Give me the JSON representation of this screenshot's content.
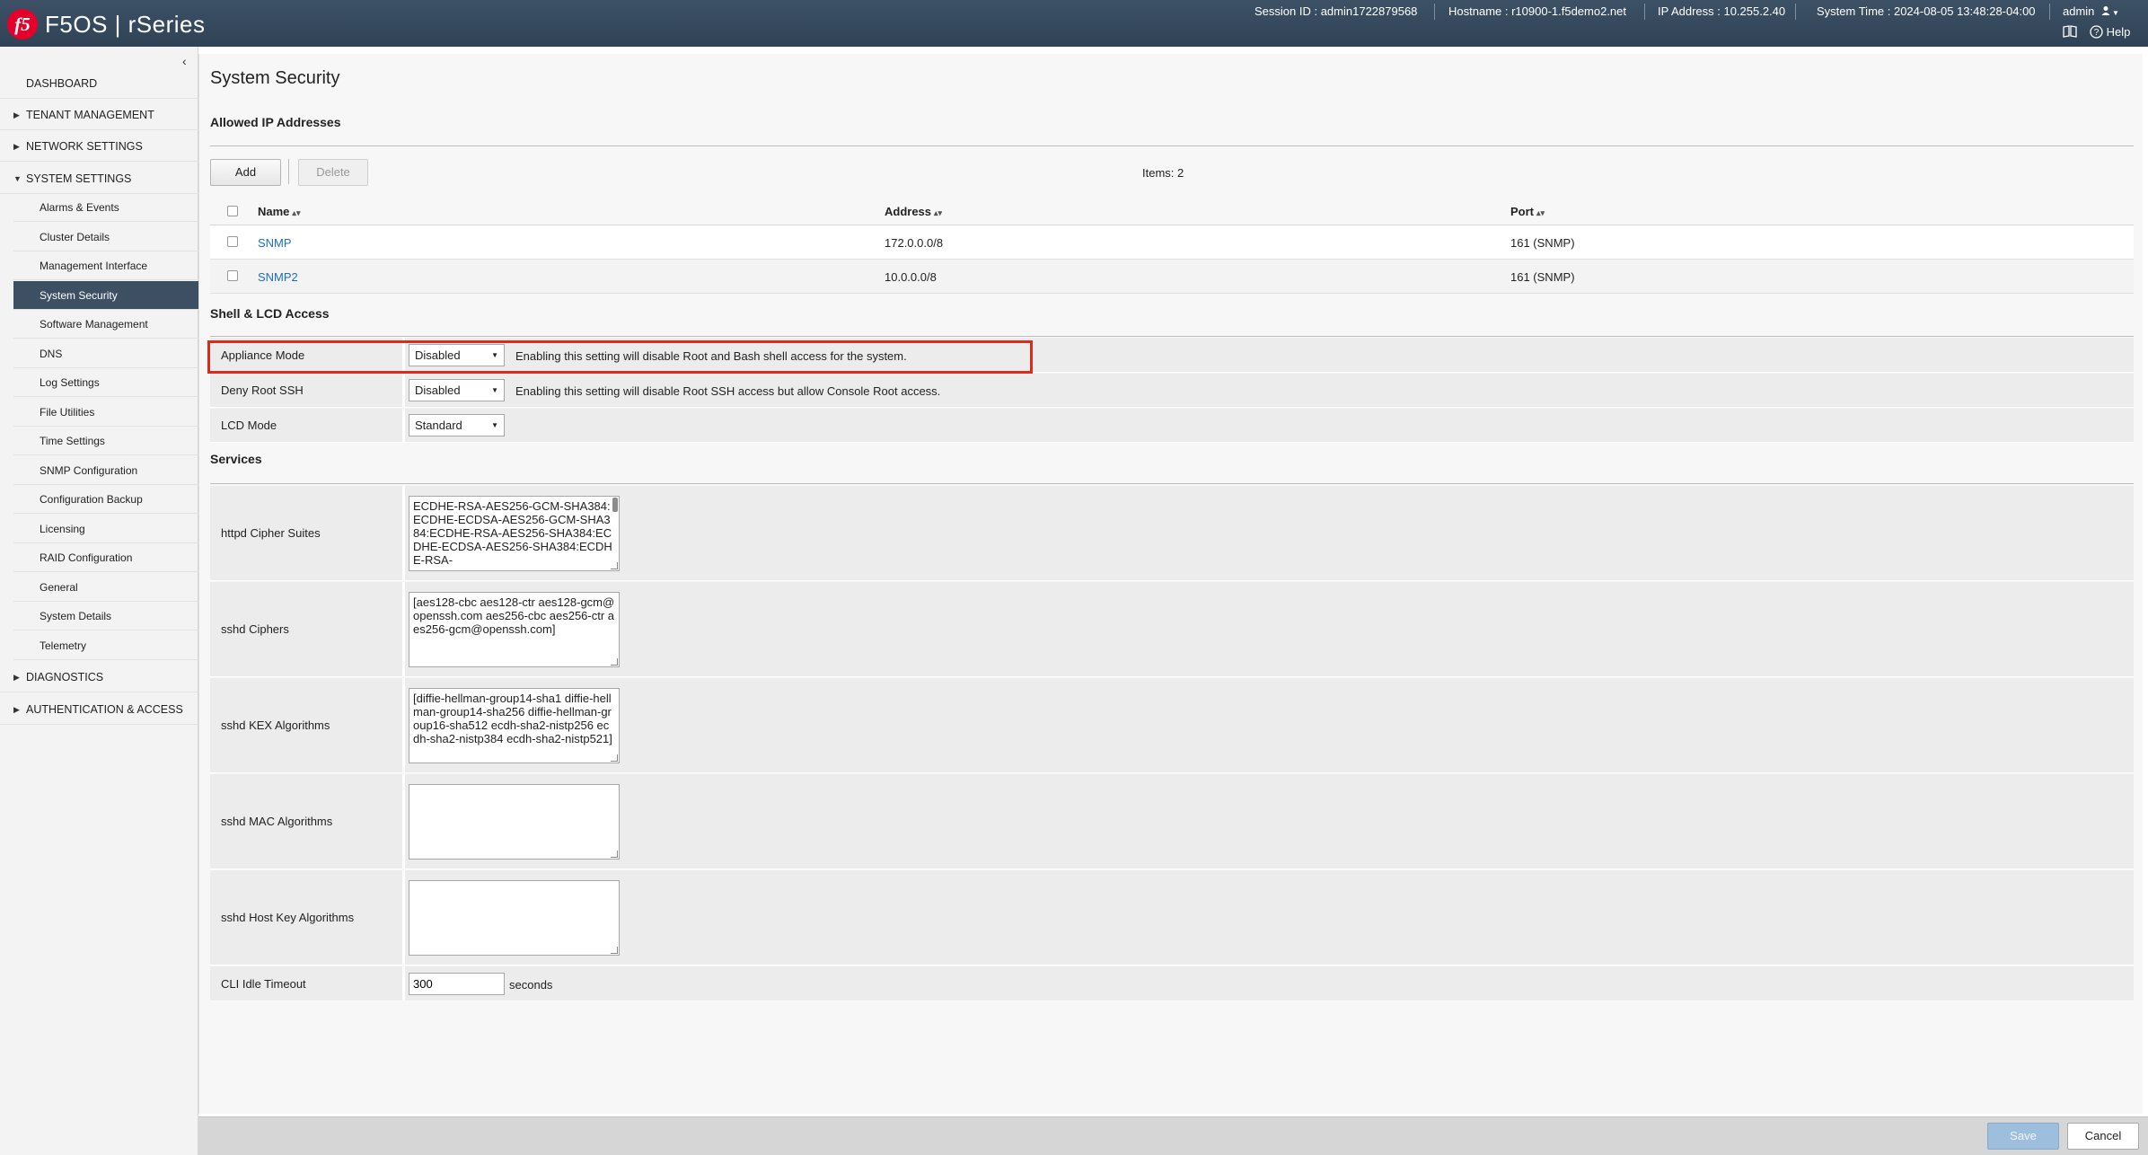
{
  "header": {
    "logo": "f5",
    "product": "F5OS | rSeries",
    "session": "Session ID : admin1722879568",
    "hostname": "Hostname : r10900-1.f5demo2.net",
    "ip": "IP Address : 10.255.2.40",
    "time": "System Time : 2024-08-05 13:48:28-04:00",
    "user": "admin",
    "help": "Help",
    "icons": {
      "user": "user-icon",
      "book": "book-icon",
      "help": "help-circle-icon"
    }
  },
  "sidebar": {
    "dashboard": "DASHBOARD",
    "tenant": "TENANT MANAGEMENT",
    "network": "NETWORK SETTINGS",
    "system": "SYSTEM SETTINGS",
    "sub": [
      "Alarms & Events",
      "Cluster Details",
      "Management Interface",
      "System Security",
      "Software Management",
      "DNS",
      "Log Settings",
      "File Utilities",
      "Time Settings",
      "SNMP Configuration",
      "Configuration Backup",
      "Licensing",
      "RAID Configuration",
      "General",
      "System Details",
      "Telemetry"
    ],
    "active_index": 3,
    "diagnostics": "DIAGNOSTICS",
    "auth": "AUTHENTICATION & ACCESS"
  },
  "page": {
    "title": "System Security"
  },
  "allowed": {
    "title": "Allowed IP Addresses",
    "add": "Add",
    "delete": "Delete",
    "items": "Items: 2",
    "columns": {
      "name": "Name",
      "address": "Address",
      "port": "Port"
    },
    "rows": [
      {
        "name": "SNMP",
        "address": "172.0.0.0/8",
        "port": "161 (SNMP)"
      },
      {
        "name": "SNMP2",
        "address": "10.0.0.0/8",
        "port": "161 (SNMP)"
      }
    ]
  },
  "shell": {
    "title": "Shell & LCD Access",
    "appliance": {
      "label": "Appliance Mode",
      "value": "Disabled",
      "help": "Enabling this setting will disable Root and Bash shell access for the system."
    },
    "deny_root": {
      "label": "Deny Root SSH",
      "value": "Disabled",
      "help": "Enabling this setting will disable Root SSH access but allow Console Root access."
    },
    "lcd": {
      "label": "LCD Mode",
      "value": "Standard"
    }
  },
  "services": {
    "title": "Services",
    "httpd": {
      "label": "httpd Cipher Suites",
      "value": "ECDHE-RSA-AES256-GCM-SHA384:ECDHE-ECDSA-AES256-GCM-SHA384:ECDHE-RSA-AES256-SHA384:ECDHE-ECDSA-AES256-SHA384:ECDHE-RSA-"
    },
    "ciphers": {
      "label": "sshd Ciphers",
      "value": "[aes128-cbc aes128-ctr aes128-gcm@openssh.com aes256-cbc aes256-ctr aes256-gcm@openssh.com]"
    },
    "kex": {
      "label": "sshd KEX Algorithms",
      "value": "[diffie-hellman-group14-sha1 diffie-hellman-group14-sha256 diffie-hellman-group16-sha512 ecdh-sha2-nistp256 ecdh-sha2-nistp384 ecdh-sha2-nistp521]"
    },
    "mac": {
      "label": "sshd MAC Algorithms",
      "value": ""
    },
    "hostkey": {
      "label": "sshd Host Key Algorithms",
      "value": ""
    },
    "cli": {
      "label": "CLI Idle Timeout",
      "value": "300",
      "unit": "seconds"
    }
  },
  "footer": {
    "save": "Save",
    "cancel": "Cancel"
  }
}
